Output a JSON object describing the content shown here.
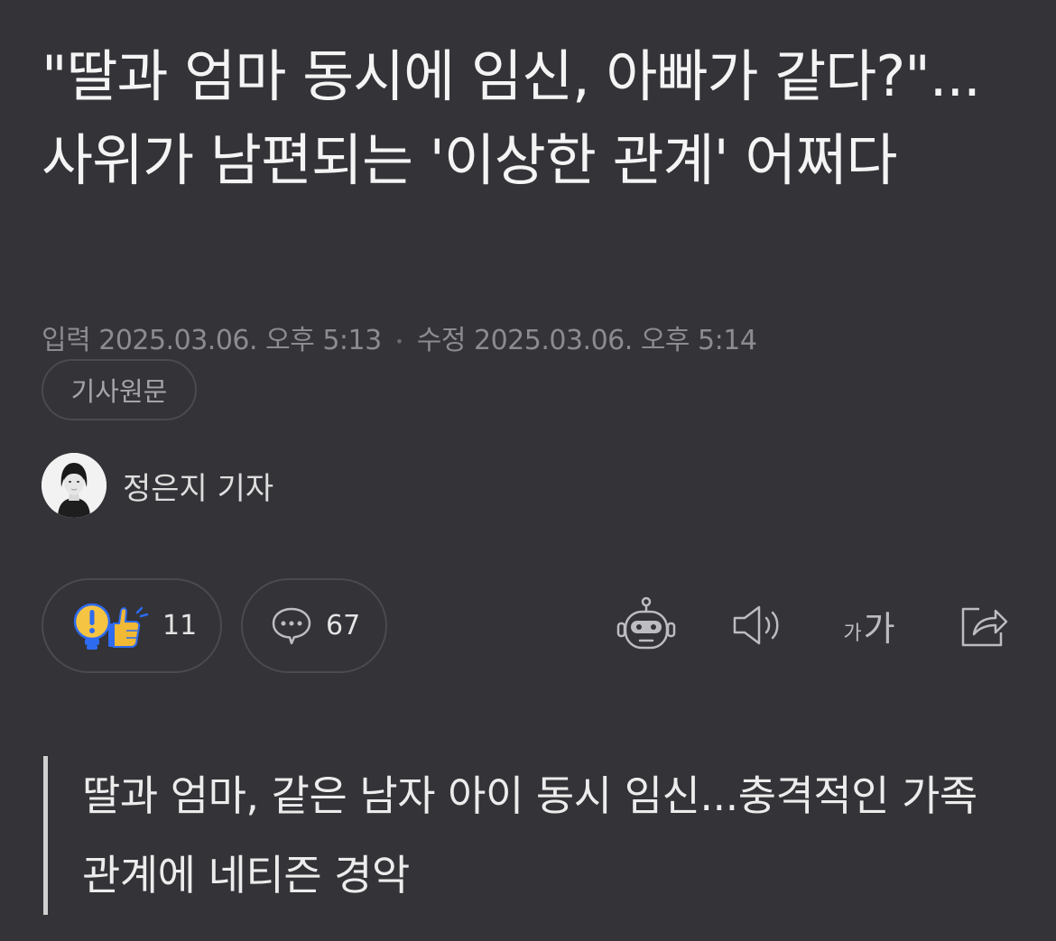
{
  "article": {
    "headline": "\"딸과 엄마 동시에 임신, 아빠가 같다?\"...사위가 남편되는 '이상한 관계' 어쩌다",
    "input_label": "입력",
    "input_date": "2025.03.06. 오후 5:13",
    "date_separator": "•",
    "edit_label": "수정",
    "edit_date": "2025.03.06. 오후 5:14",
    "original_button": "기사원문",
    "author": "정은지 기자",
    "summary": "딸과 엄마, 같은 남자 아이 동시 임신...충격적인 가족 관계에 네티즌 경악"
  },
  "actions": {
    "reaction_count": "11",
    "comment_count": "67",
    "font_size_small": "가",
    "font_size_large": "가"
  },
  "icons": {
    "reaction": "lightbulb-thumbsup-icon",
    "comment": "comment-bubble-icon",
    "summary_bot": "robot-icon",
    "read_aloud": "speaker-icon",
    "font_size": "font-size-icon",
    "share": "share-icon"
  },
  "colors": {
    "background": "#333338",
    "headline": "#f4f4f4",
    "meta_text": "#8c8c90",
    "border": "#4a4a4f",
    "bulb_yellow": "#f6c443",
    "thumb_yellow": "#f2b935",
    "accent_blue": "#2d6bf0"
  }
}
